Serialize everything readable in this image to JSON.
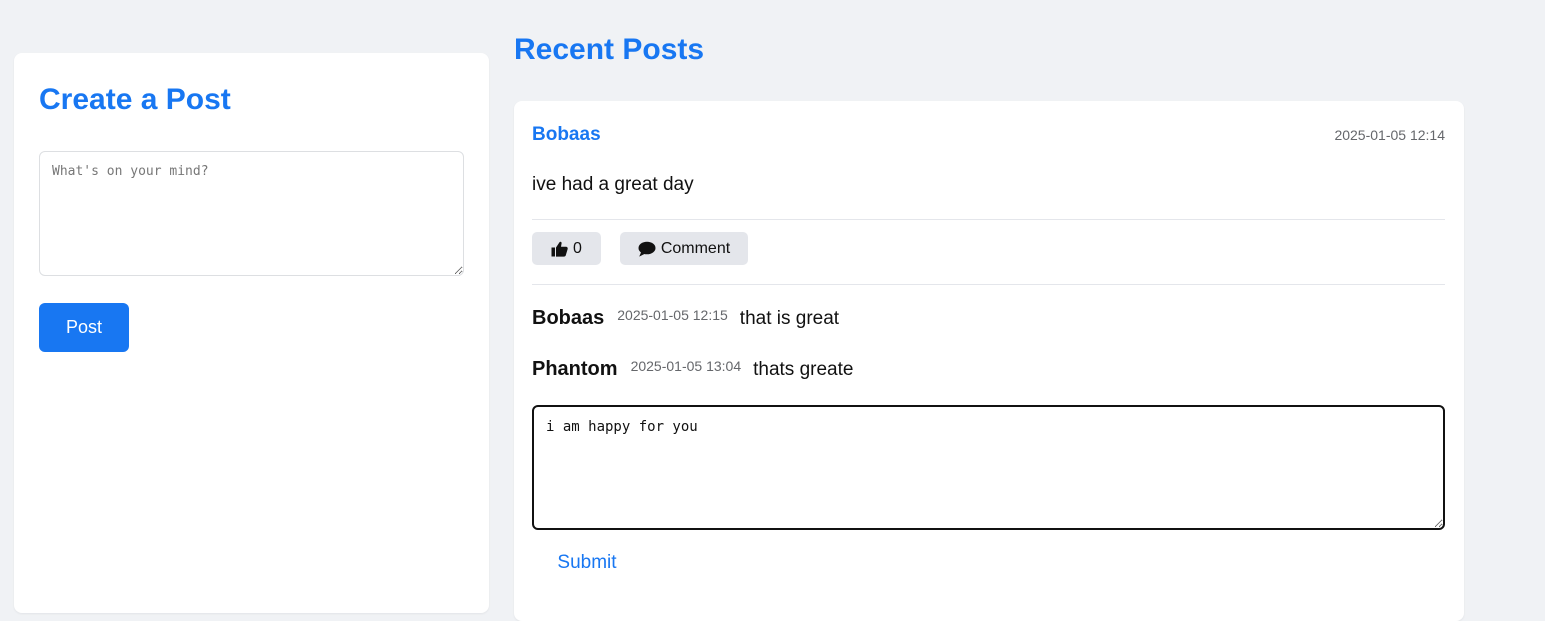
{
  "create_post": {
    "title": "Create a Post",
    "placeholder": "What's on your mind?",
    "button_label": "Post"
  },
  "feed": {
    "title": "Recent Posts",
    "posts": [
      {
        "author": "Bobaas",
        "time": "2025-01-05 12:14",
        "content": "ive had a great day",
        "like_count": "0",
        "comment_label": "Comment",
        "comments": [
          {
            "author": "Bobaas",
            "time": "2025-01-05 12:15",
            "text": "that is great"
          },
          {
            "author": "Phantom",
            "time": "2025-01-05 13:04",
            "text": "thats greate"
          }
        ],
        "comment_input_value": "i am happy for you",
        "submit_label": "Submit"
      }
    ]
  },
  "colors": {
    "accent": "#1877f2",
    "page_bg": "#f0f2f5",
    "button_bg": "#e4e6eb"
  },
  "icons": {
    "like": "thumbs-up-icon",
    "comment": "comment-bubble-icon"
  }
}
